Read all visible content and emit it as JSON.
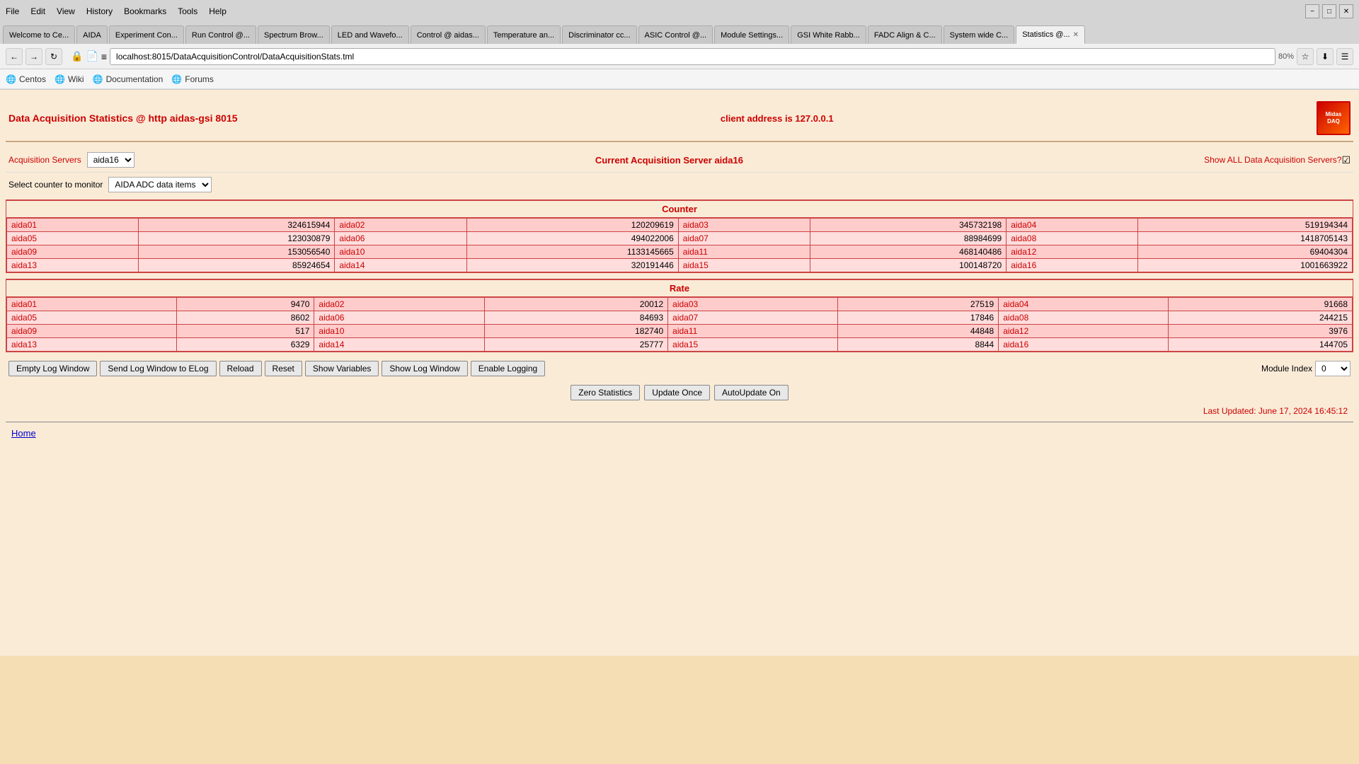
{
  "browser": {
    "menu_items": [
      "File",
      "Edit",
      "View",
      "History",
      "Bookmarks",
      "Tools",
      "Help"
    ],
    "tabs": [
      {
        "label": "Welcome to Ce...",
        "active": false
      },
      {
        "label": "AIDA",
        "active": false
      },
      {
        "label": "Experiment Con...",
        "active": false
      },
      {
        "label": "Run Control @...",
        "active": false
      },
      {
        "label": "Spectrum Brow...",
        "active": false
      },
      {
        "label": "LED and Wavefo...",
        "active": false
      },
      {
        "label": "Control @ aidas...",
        "active": false
      },
      {
        "label": "Temperature an...",
        "active": false
      },
      {
        "label": "Discriminator cc...",
        "active": false
      },
      {
        "label": "ASIC Control @...",
        "active": false
      },
      {
        "label": "Module Settings...",
        "active": false
      },
      {
        "label": "GSI White Rabb...",
        "active": false
      },
      {
        "label": "FADC Align & C...",
        "active": false
      },
      {
        "label": "System wide C...",
        "active": false
      },
      {
        "label": "Statistics @...",
        "active": true
      }
    ],
    "address": "localhost:8015/DataAcquisitionControl/DataAcquisitionStats.tml",
    "zoom": "80%",
    "bookmarks": [
      {
        "label": "Centos",
        "icon": "globe"
      },
      {
        "label": "Wiki",
        "icon": "globe"
      },
      {
        "label": "Documentation",
        "icon": "globe"
      },
      {
        "label": "Forums",
        "icon": "globe"
      }
    ]
  },
  "page": {
    "title": "Data Acquisition Statistics @ http aidas-gsi 8015",
    "client_address": "client address is 127.0.0.1",
    "acquisition_servers_label": "Acquisition Servers",
    "server_selected": "aida16",
    "current_server_label": "Current Acquisition Server aida16",
    "show_all_label": "Show ALL Data Acquisition Servers?",
    "select_counter_label": "Select counter to monitor",
    "counter_option": "AIDA ADC data items",
    "counter_section": "Counter",
    "rate_section": "Rate",
    "counter_data": [
      {
        "label": "aida01",
        "value": "324615944",
        "label2": "aida02",
        "value2": "120209619",
        "label3": "aida03",
        "value3": "345732198",
        "label4": "aida04",
        "value4": "519194344"
      },
      {
        "label": "aida05",
        "value": "123030879",
        "label2": "aida06",
        "value2": "494022006",
        "label3": "aida07",
        "value3": "88984699",
        "label4": "aida08",
        "value4": "1418705143"
      },
      {
        "label": "aida09",
        "value": "153056540",
        "label2": "aida10",
        "value2": "1133145665",
        "label3": "aida11",
        "value3": "468140486",
        "label4": "aida12",
        "value4": "69404304"
      },
      {
        "label": "aida13",
        "value": "85924654",
        "label2": "aida14",
        "value2": "320191446",
        "label3": "aida15",
        "value3": "100148720",
        "label4": "aida16",
        "value4": "1001663922"
      }
    ],
    "rate_data": [
      {
        "label": "aida01",
        "value": "9470",
        "label2": "aida02",
        "value2": "20012",
        "label3": "aida03",
        "value3": "27519",
        "label4": "aida04",
        "value4": "91668"
      },
      {
        "label": "aida05",
        "value": "8602",
        "label2": "aida06",
        "value2": "84693",
        "label3": "aida07",
        "value3": "17846",
        "label4": "aida08",
        "value4": "244215"
      },
      {
        "label": "aida09",
        "value": "517",
        "label2": "aida10",
        "value2": "182740",
        "label3": "aida11",
        "value3": "44848",
        "label4": "aida12",
        "value4": "3976"
      },
      {
        "label": "aida13",
        "value": "6329",
        "label2": "aida14",
        "value2": "25777",
        "label3": "aida15",
        "value3": "8844",
        "label4": "aida16",
        "value4": "144705"
      }
    ],
    "buttons": {
      "empty_log": "Empty Log Window",
      "send_log": "Send Log Window to ELog",
      "reload": "Reload",
      "reset": "Reset",
      "show_variables": "Show Variables",
      "show_log_window": "Show Log Window",
      "enable_logging": "Enable Logging",
      "module_index_label": "Module Index",
      "module_index_value": "0",
      "zero_statistics": "Zero Statistics",
      "update_once": "Update Once",
      "auto_update_on": "AutoUpdate On"
    },
    "last_updated": "Last Updated: June 17, 2024 16:45:12",
    "home_link": "Home"
  }
}
